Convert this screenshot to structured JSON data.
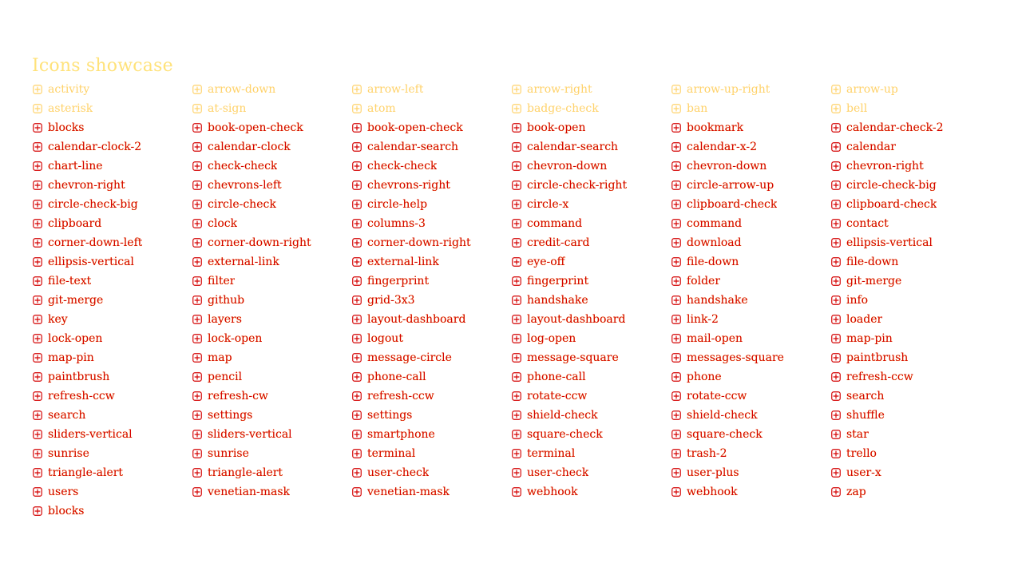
{
  "page": {
    "title": "Icons showcase"
  },
  "colors": {
    "primary": "#d40000",
    "faded": "#ffd26a",
    "title": "#ffe27a"
  },
  "icons": [
    {
      "label": "activity",
      "icon": "activity-icon",
      "faded": true
    },
    {
      "label": "arrow-down",
      "icon": "arrow-down-icon",
      "faded": true
    },
    {
      "label": "arrow-left",
      "icon": "arrow-left-icon",
      "faded": true
    },
    {
      "label": "arrow-right",
      "icon": "arrow-right-icon",
      "faded": true
    },
    {
      "label": "arrow-up-right",
      "icon": "arrow-up-right-icon",
      "faded": true
    },
    {
      "label": "arrow-up",
      "icon": "arrow-up-icon",
      "faded": true
    },
    {
      "label": "asterisk",
      "icon": "asterisk-icon",
      "faded": true
    },
    {
      "label": "at-sign",
      "icon": "at-sign-icon",
      "faded": true
    },
    {
      "label": "atom",
      "icon": "atom-icon",
      "faded": true
    },
    {
      "label": "badge-check",
      "icon": "badge-check-icon",
      "faded": true
    },
    {
      "label": "ban",
      "icon": "ban-icon",
      "faded": true
    },
    {
      "label": "bell",
      "icon": "bell-icon",
      "faded": true
    },
    {
      "label": "blocks",
      "icon": "blocks-icon",
      "faded": false
    },
    {
      "label": "book-open-check",
      "icon": "book-open-check-icon",
      "faded": false
    },
    {
      "label": "book-open-check",
      "icon": "book-open-check-icon",
      "faded": false
    },
    {
      "label": "book-open",
      "icon": "book-open-icon",
      "faded": false
    },
    {
      "label": "bookmark",
      "icon": "bookmark-icon",
      "faded": false
    },
    {
      "label": "calendar-check-2",
      "icon": "calendar-check-icon",
      "faded": false
    },
    {
      "label": "calendar-clock-2",
      "icon": "calendar-clock-icon",
      "faded": false
    },
    {
      "label": "calendar-clock",
      "icon": "calendar-clock-icon",
      "faded": false
    },
    {
      "label": "calendar-search",
      "icon": "calendar-search-icon",
      "faded": false
    },
    {
      "label": "calendar-search",
      "icon": "calendar-search-icon",
      "faded": false
    },
    {
      "label": "calendar-x-2",
      "icon": "calendar-x-icon",
      "faded": false
    },
    {
      "label": "calendar",
      "icon": "calendar-icon",
      "faded": false
    },
    {
      "label": "chart-line",
      "icon": "chart-line-icon",
      "faded": false
    },
    {
      "label": "check-check",
      "icon": "check-check-icon",
      "faded": false
    },
    {
      "label": "check-check",
      "icon": "check-check-icon",
      "faded": false
    },
    {
      "label": "chevron-down",
      "icon": "chevron-down-icon",
      "faded": false
    },
    {
      "label": "chevron-down",
      "icon": "chevron-down-icon",
      "faded": false
    },
    {
      "label": "chevron-right",
      "icon": "chevron-right-icon",
      "faded": false
    },
    {
      "label": "chevron-right",
      "icon": "chevron-right-icon",
      "faded": false
    },
    {
      "label": "chevrons-left",
      "icon": "chevrons-left-icon",
      "faded": false
    },
    {
      "label": "chevrons-right",
      "icon": "chevrons-right-icon",
      "faded": false
    },
    {
      "label": "circle-check-right",
      "icon": "circle-check-icon",
      "faded": false
    },
    {
      "label": "circle-arrow-up",
      "icon": "circle-arrow-up-icon",
      "faded": false
    },
    {
      "label": "circle-check-big",
      "icon": "circle-check-big-icon",
      "faded": false
    },
    {
      "label": "circle-check-big",
      "icon": "circle-check-big-icon",
      "faded": false
    },
    {
      "label": "circle-check",
      "icon": "circle-check-icon",
      "faded": false
    },
    {
      "label": "circle-help",
      "icon": "circle-help-icon",
      "faded": false
    },
    {
      "label": "circle-x",
      "icon": "circle-x-icon",
      "faded": false
    },
    {
      "label": "clipboard-check",
      "icon": "clipboard-check-icon",
      "faded": false
    },
    {
      "label": "clipboard-check",
      "icon": "clipboard-check-icon",
      "faded": false
    },
    {
      "label": "clipboard",
      "icon": "clipboard-icon",
      "faded": false
    },
    {
      "label": "clock",
      "icon": "clock-icon",
      "faded": false
    },
    {
      "label": "columns-3",
      "icon": "columns-3-icon",
      "faded": false
    },
    {
      "label": "command",
      "icon": "command-icon",
      "faded": false
    },
    {
      "label": "command",
      "icon": "command-icon",
      "faded": false
    },
    {
      "label": "contact",
      "icon": "contact-icon",
      "faded": false
    },
    {
      "label": "corner-down-left",
      "icon": "corner-down-left-icon",
      "faded": false
    },
    {
      "label": "corner-down-right",
      "icon": "corner-down-right-icon",
      "faded": false
    },
    {
      "label": "corner-down-right",
      "icon": "corner-down-right-icon",
      "faded": false
    },
    {
      "label": "credit-card",
      "icon": "credit-card-icon",
      "faded": false
    },
    {
      "label": "download",
      "icon": "download-icon",
      "faded": false
    },
    {
      "label": "ellipsis-vertical",
      "icon": "ellipsis-vertical-icon",
      "faded": false
    },
    {
      "label": "ellipsis-vertical",
      "icon": "ellipsis-vertical-icon",
      "faded": false
    },
    {
      "label": "external-link",
      "icon": "external-link-icon",
      "faded": false
    },
    {
      "label": "external-link",
      "icon": "external-link-icon",
      "faded": false
    },
    {
      "label": "eye-off",
      "icon": "eye-off-icon",
      "faded": false
    },
    {
      "label": "file-down",
      "icon": "file-down-icon",
      "faded": false
    },
    {
      "label": "file-down",
      "icon": "file-down-icon",
      "faded": false
    },
    {
      "label": "file-text",
      "icon": "file-text-icon",
      "faded": false
    },
    {
      "label": "filter",
      "icon": "filter-icon",
      "faded": false
    },
    {
      "label": "fingerprint",
      "icon": "fingerprint-icon",
      "faded": false
    },
    {
      "label": "fingerprint",
      "icon": "fingerprint-icon",
      "faded": false
    },
    {
      "label": "folder",
      "icon": "folder-icon",
      "faded": false
    },
    {
      "label": "git-merge",
      "icon": "git-merge-icon",
      "faded": false
    },
    {
      "label": "git-merge",
      "icon": "git-merge-icon",
      "faded": false
    },
    {
      "label": "github",
      "icon": "github-icon",
      "faded": false
    },
    {
      "label": "grid-3x3",
      "icon": "grid-3x3-icon",
      "faded": false
    },
    {
      "label": "handshake",
      "icon": "handshake-icon",
      "faded": false
    },
    {
      "label": "handshake",
      "icon": "handshake-icon",
      "faded": false
    },
    {
      "label": "info",
      "icon": "info-icon",
      "faded": false
    },
    {
      "label": "key",
      "icon": "key-icon",
      "faded": false
    },
    {
      "label": "layers",
      "icon": "layers-icon",
      "faded": false
    },
    {
      "label": "layout-dashboard",
      "icon": "layout-dashboard-icon",
      "faded": false
    },
    {
      "label": "layout-dashboard",
      "icon": "layout-dashboard-icon",
      "faded": false
    },
    {
      "label": "link-2",
      "icon": "link-icon",
      "faded": false
    },
    {
      "label": "loader",
      "icon": "loader-icon",
      "faded": false
    },
    {
      "label": "lock-open",
      "icon": "lock-open-icon",
      "faded": false
    },
    {
      "label": "lock-open",
      "icon": "lock-open-icon",
      "faded": false
    },
    {
      "label": "logout",
      "icon": "logout-icon",
      "faded": false
    },
    {
      "label": "log-open",
      "icon": "log-open-icon",
      "faded": false
    },
    {
      "label": "mail-open",
      "icon": "mail-open-icon",
      "faded": false
    },
    {
      "label": "map-pin",
      "icon": "map-pin-icon",
      "faded": false
    },
    {
      "label": "map-pin",
      "icon": "map-pin-icon",
      "faded": false
    },
    {
      "label": "map",
      "icon": "map-icon",
      "faded": false
    },
    {
      "label": "message-circle",
      "icon": "message-circle-icon",
      "faded": false
    },
    {
      "label": "message-square",
      "icon": "message-square-icon",
      "faded": false
    },
    {
      "label": "messages-square",
      "icon": "messages-square-icon",
      "faded": false
    },
    {
      "label": "paintbrush",
      "icon": "paintbrush-icon",
      "faded": false
    },
    {
      "label": "paintbrush",
      "icon": "paintbrush-icon",
      "faded": false
    },
    {
      "label": "pencil",
      "icon": "pencil-icon",
      "faded": false
    },
    {
      "label": "phone-call",
      "icon": "phone-call-icon",
      "faded": false
    },
    {
      "label": "phone-call",
      "icon": "phone-call-icon",
      "faded": false
    },
    {
      "label": "phone",
      "icon": "phone-icon",
      "faded": false
    },
    {
      "label": "refresh-ccw",
      "icon": "refresh-ccw-icon",
      "faded": false
    },
    {
      "label": "refresh-ccw",
      "icon": "refresh-ccw-icon",
      "faded": false
    },
    {
      "label": "refresh-cw",
      "icon": "refresh-cw-icon",
      "faded": false
    },
    {
      "label": "refresh-ccw",
      "icon": "refresh-ccw-icon",
      "faded": false
    },
    {
      "label": "rotate-ccw",
      "icon": "rotate-ccw-icon",
      "faded": false
    },
    {
      "label": "rotate-ccw",
      "icon": "rotate-ccw-icon",
      "faded": false
    },
    {
      "label": "search",
      "icon": "search-icon",
      "faded": false
    },
    {
      "label": "search",
      "icon": "search-icon",
      "faded": false
    },
    {
      "label": "settings",
      "icon": "settings-icon",
      "faded": false
    },
    {
      "label": "settings",
      "icon": "settings-icon",
      "faded": false
    },
    {
      "label": "shield-check",
      "icon": "shield-check-icon",
      "faded": false
    },
    {
      "label": "shield-check",
      "icon": "shield-check-icon",
      "faded": false
    },
    {
      "label": "shuffle",
      "icon": "shuffle-icon",
      "faded": false
    },
    {
      "label": "sliders-vertical",
      "icon": "sliders-vertical-icon",
      "faded": false
    },
    {
      "label": "sliders-vertical",
      "icon": "sliders-vertical-icon",
      "faded": false
    },
    {
      "label": "smartphone",
      "icon": "smartphone-icon",
      "faded": false
    },
    {
      "label": "square-check",
      "icon": "square-check-icon",
      "faded": false
    },
    {
      "label": "square-check",
      "icon": "square-check-icon",
      "faded": false
    },
    {
      "label": "star",
      "icon": "star-icon",
      "faded": false
    },
    {
      "label": "sunrise",
      "icon": "sunrise-icon",
      "faded": false
    },
    {
      "label": "sunrise",
      "icon": "sunrise-icon",
      "faded": false
    },
    {
      "label": "terminal",
      "icon": "terminal-icon",
      "faded": false
    },
    {
      "label": "terminal",
      "icon": "terminal-icon",
      "faded": false
    },
    {
      "label": "trash-2",
      "icon": "trash-icon",
      "faded": false
    },
    {
      "label": "trello",
      "icon": "trello-icon",
      "faded": false
    },
    {
      "label": "triangle-alert",
      "icon": "triangle-alert-icon",
      "faded": false
    },
    {
      "label": "triangle-alert",
      "icon": "triangle-alert-icon",
      "faded": false
    },
    {
      "label": "user-check",
      "icon": "user-check-icon",
      "faded": false
    },
    {
      "label": "user-check",
      "icon": "user-check-icon",
      "faded": false
    },
    {
      "label": "user-plus",
      "icon": "user-plus-icon",
      "faded": false
    },
    {
      "label": "user-x",
      "icon": "user-x-icon",
      "faded": false
    },
    {
      "label": "users",
      "icon": "users-icon",
      "faded": false
    },
    {
      "label": "venetian-mask",
      "icon": "venetian-mask-icon",
      "faded": false
    },
    {
      "label": "venetian-mask",
      "icon": "venetian-mask-icon",
      "faded": false
    },
    {
      "label": "webhook",
      "icon": "webhook-icon",
      "faded": false
    },
    {
      "label": "webhook",
      "icon": "webhook-icon",
      "faded": false
    },
    {
      "label": "zap",
      "icon": "zap-icon",
      "faded": false
    },
    {
      "label": "blocks",
      "icon": "blocks-icon",
      "faded": false
    }
  ]
}
